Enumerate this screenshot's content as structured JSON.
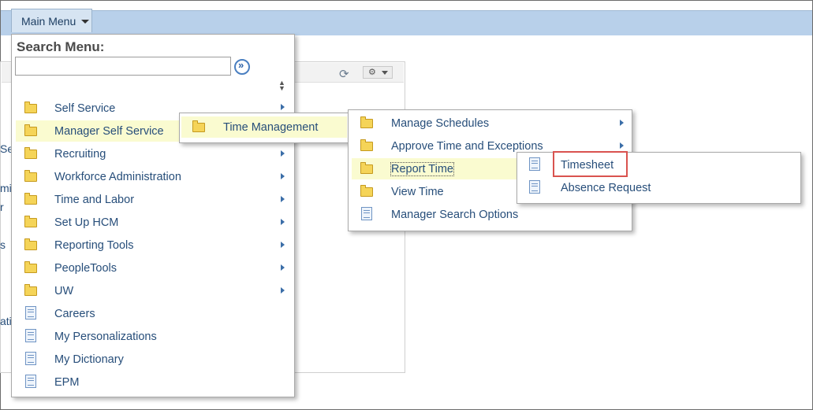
{
  "main_menu": {
    "label": "Main Menu"
  },
  "search": {
    "title": "Search Menu:",
    "value": "",
    "placeholder": ""
  },
  "menu1": {
    "items": [
      {
        "label": "Self Service",
        "icon": "folder-icon"
      },
      {
        "label": "Manager Self Service",
        "icon": "folder-icon"
      },
      {
        "label": "Recruiting",
        "icon": "folder-icon"
      },
      {
        "label": "Workforce Administration",
        "icon": "folder-icon"
      },
      {
        "label": "Time and Labor",
        "icon": "folder-icon"
      },
      {
        "label": "Set Up HCM",
        "icon": "folder-icon"
      },
      {
        "label": "Reporting Tools",
        "icon": "folder-icon"
      },
      {
        "label": "PeopleTools",
        "icon": "folder-icon"
      },
      {
        "label": "UW",
        "icon": "folder-icon"
      },
      {
        "label": "Careers",
        "icon": "document-icon"
      },
      {
        "label": "My Personalizations",
        "icon": "document-icon"
      },
      {
        "label": "My Dictionary",
        "icon": "document-icon"
      },
      {
        "label": "EPM",
        "icon": "document-icon"
      }
    ]
  },
  "menu2": {
    "items": [
      {
        "label": "Time Management",
        "icon": "folder-icon"
      }
    ]
  },
  "menu3": {
    "items": [
      {
        "label": "Manage Schedules",
        "icon": "folder-icon"
      },
      {
        "label": "Approve Time and Exceptions",
        "icon": "folder-icon"
      },
      {
        "label": "Report Time",
        "icon": "folder-icon"
      },
      {
        "label": "View Time",
        "icon": "folder-icon"
      },
      {
        "label": "Manager Search Options",
        "icon": "document-icon"
      }
    ]
  },
  "menu4": {
    "items": [
      {
        "label": "Timesheet",
        "icon": "document-icon"
      },
      {
        "label": "Absence Request",
        "icon": "document-icon"
      }
    ]
  },
  "background": {
    "fragments": [
      "Se",
      "mi",
      "r",
      "s",
      "ati"
    ]
  },
  "colors": {
    "topbar": "#b8d0ea",
    "highlight_row": "#fafbd0",
    "callout_border": "#d9534f",
    "link_text": "#274e7a"
  }
}
